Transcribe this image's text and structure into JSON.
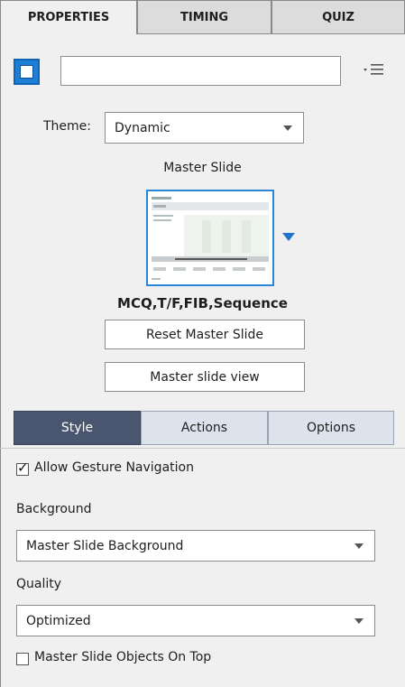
{
  "tabs": [
    "PROPERTIES",
    "TIMING",
    "QUIZ"
  ],
  "slide_name": {
    "value": ""
  },
  "theme": {
    "label": "Theme:",
    "selected": "Dynamic"
  },
  "master_slide": {
    "title": "Master Slide",
    "name": "MCQ,T/F,FIB,Sequence",
    "reset_label": "Reset Master Slide",
    "view_label": "Master slide view"
  },
  "sub_tabs": [
    "Style",
    "Actions",
    "Options"
  ],
  "style": {
    "gesture_label": "Allow Gesture Navigation",
    "gesture_checked": true,
    "background_label": "Background",
    "background_selected": "Master Slide Background",
    "quality_label": "Quality",
    "quality_selected": "Optimized",
    "objects_on_top_label": "Master Slide Objects On Top",
    "objects_on_top_checked": false
  },
  "colors": {
    "accent": "#1e7fd6",
    "active_subtab": "#4a5670"
  }
}
